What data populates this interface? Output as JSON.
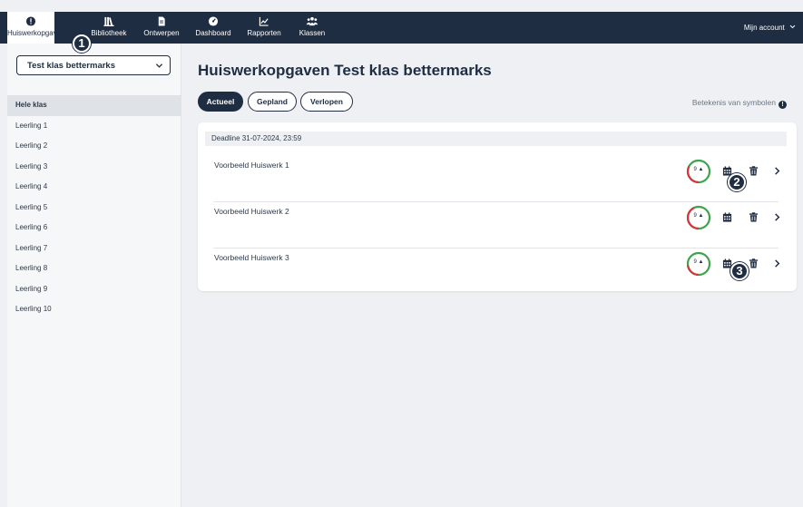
{
  "nav": {
    "items": [
      {
        "label": "Huiswerkopgaven",
        "icon": "exclamation-circle-icon"
      },
      {
        "label": "Bibliotheek",
        "icon": "library-books-icon"
      },
      {
        "label": "Ontwerpen",
        "icon": "document-icon"
      },
      {
        "label": "Dashboard",
        "icon": "gauge-icon"
      },
      {
        "label": "Rapporten",
        "icon": "line-chart-icon"
      },
      {
        "label": "Klassen",
        "icon": "users-icon"
      }
    ],
    "account_label": "Mijn account"
  },
  "badges": [
    "1",
    "2",
    "3"
  ],
  "sidebar": {
    "selected_class": "Test klas bettermarks",
    "items": [
      "Hele klas",
      "Leerling 1",
      "Leerling 2",
      "Leerling 3",
      "Leerling 4",
      "Leerling 5",
      "Leerling 6",
      "Leerling 7",
      "Leerling 8",
      "Leerling 9",
      "Leerling 10"
    ]
  },
  "main": {
    "title": "Huiswerkopgaven Test klas bettermarks",
    "tabs": [
      "Actueel",
      "Gepland",
      "Verlopen"
    ],
    "legend_label": "Betekenis van symbolen",
    "deadline": "Deadline 31-07-2024, 23:59",
    "assignments": [
      {
        "name": "Voorbeeld Huiswerk 1",
        "students": "9",
        "done_fraction": 0.35
      },
      {
        "name": "Voorbeeld Huiswerk 2",
        "students": "9",
        "done_fraction": 0.15
      },
      {
        "name": "Voorbeeld Huiswerk 3",
        "students": "9",
        "done_fraction": 0.55
      }
    ]
  },
  "colors": {
    "navy": "#1f2d43",
    "ring_done": "#3fa34d",
    "ring_todo": "#d8343a"
  }
}
